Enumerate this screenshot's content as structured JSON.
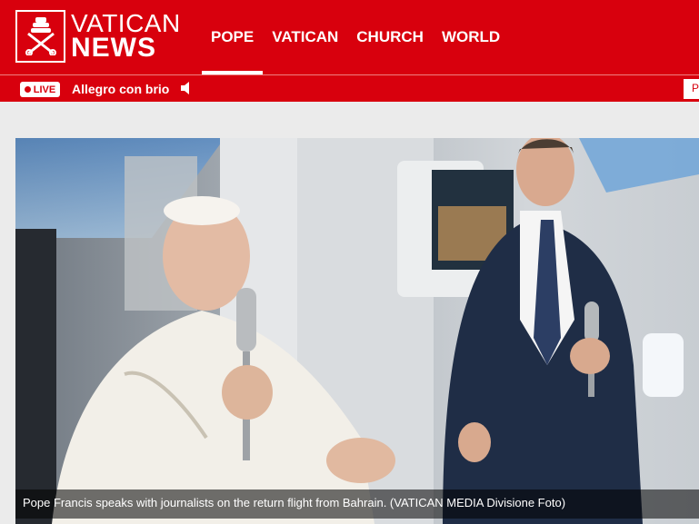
{
  "brand": {
    "line1": "VATICAN",
    "line2": "NEWS"
  },
  "nav": {
    "items": [
      "POPE",
      "VATICAN",
      "CHURCH",
      "WORLD"
    ],
    "active": "POPE"
  },
  "live": {
    "badge": "LIVE",
    "program": "Allegro con brio",
    "right_box": "P"
  },
  "photo": {
    "caption": "Pope Francis speaks with journalists on the return flight from Bahrain.  (VATICAN MEDIA Divisione Foto)"
  },
  "colors": {
    "brand_red": "#d8000d"
  }
}
